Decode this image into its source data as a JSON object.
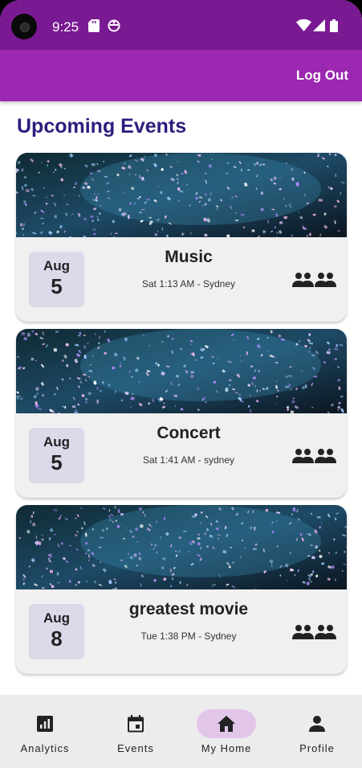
{
  "status_bar": {
    "time": "9:25",
    "icons": [
      "sd-card-icon",
      "sync-icon",
      "wifi-icon",
      "signal-icon",
      "battery-icon"
    ]
  },
  "app_bar": {
    "logout_label": "Log Out"
  },
  "section_title": "Upcoming Events",
  "events": [
    {
      "month": "Aug",
      "day": "5",
      "title": "Music",
      "subtitle": "Sat 1:13 AM - Sydney"
    },
    {
      "month": "Aug",
      "day": "5",
      "title": "Concert",
      "subtitle": "Sat 1:41 AM - sydney"
    },
    {
      "month": "Aug",
      "day": "8",
      "title": "greatest movie",
      "subtitle": "Tue 1:38 PM - Sydney"
    }
  ],
  "bottom_nav": {
    "items": [
      {
        "label": "Analytics",
        "icon": "analytics-icon"
      },
      {
        "label": "Events",
        "icon": "calendar-icon"
      },
      {
        "label": "My Home",
        "icon": "home-icon",
        "active": true
      },
      {
        "label": "Profile",
        "icon": "person-icon"
      }
    ]
  },
  "colors": {
    "status_bar": "#7a1a92",
    "app_bar": "#9c27b0",
    "title": "#2b1f7e",
    "date_badge": "#dcd9ea",
    "active_pill": "#e2c6ea"
  }
}
